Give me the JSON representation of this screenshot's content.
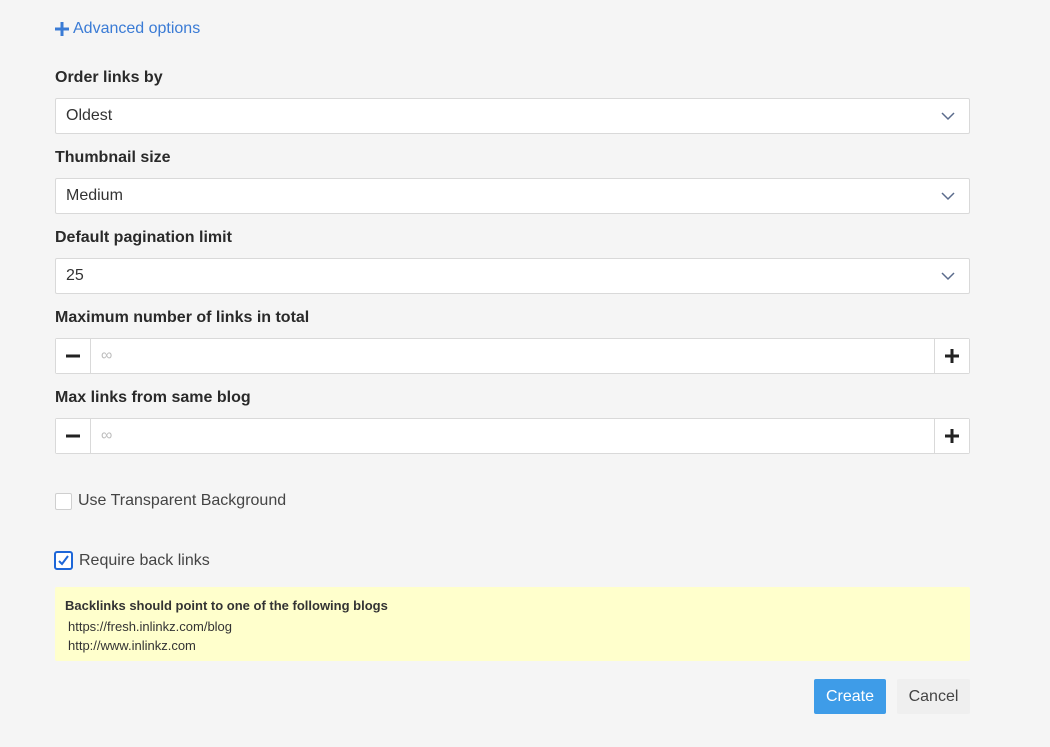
{
  "advanced_options": {
    "label": "Advanced options",
    "icon": "plus-icon"
  },
  "order_links": {
    "label": "Order links by",
    "value": "Oldest"
  },
  "thumbnail_size": {
    "label": "Thumbnail size",
    "value": "Medium"
  },
  "pagination": {
    "label": "Default pagination limit",
    "value": "25"
  },
  "max_links_total": {
    "label": "Maximum number of links in total",
    "placeholder": "∞"
  },
  "max_links_blog": {
    "label": "Max links from same blog",
    "placeholder": "∞"
  },
  "transparent_bg": {
    "label": "Use Transparent Background",
    "checked": false
  },
  "require_back_links": {
    "label": "Require back links",
    "checked": true
  },
  "backlinks_notice": {
    "title": "Backlinks should point to one of the following blogs",
    "urls": [
      "https://fresh.inlinkz.com/blog",
      "http://www.inlinkz.com"
    ]
  },
  "actions": {
    "create_label": "Create",
    "cancel_label": "Cancel"
  },
  "colors": {
    "link": "#3a7bd5",
    "primary_button": "#3e9ce8",
    "notice_bg": "#ffffcc",
    "checkbox_accent": "#1d66d8"
  }
}
